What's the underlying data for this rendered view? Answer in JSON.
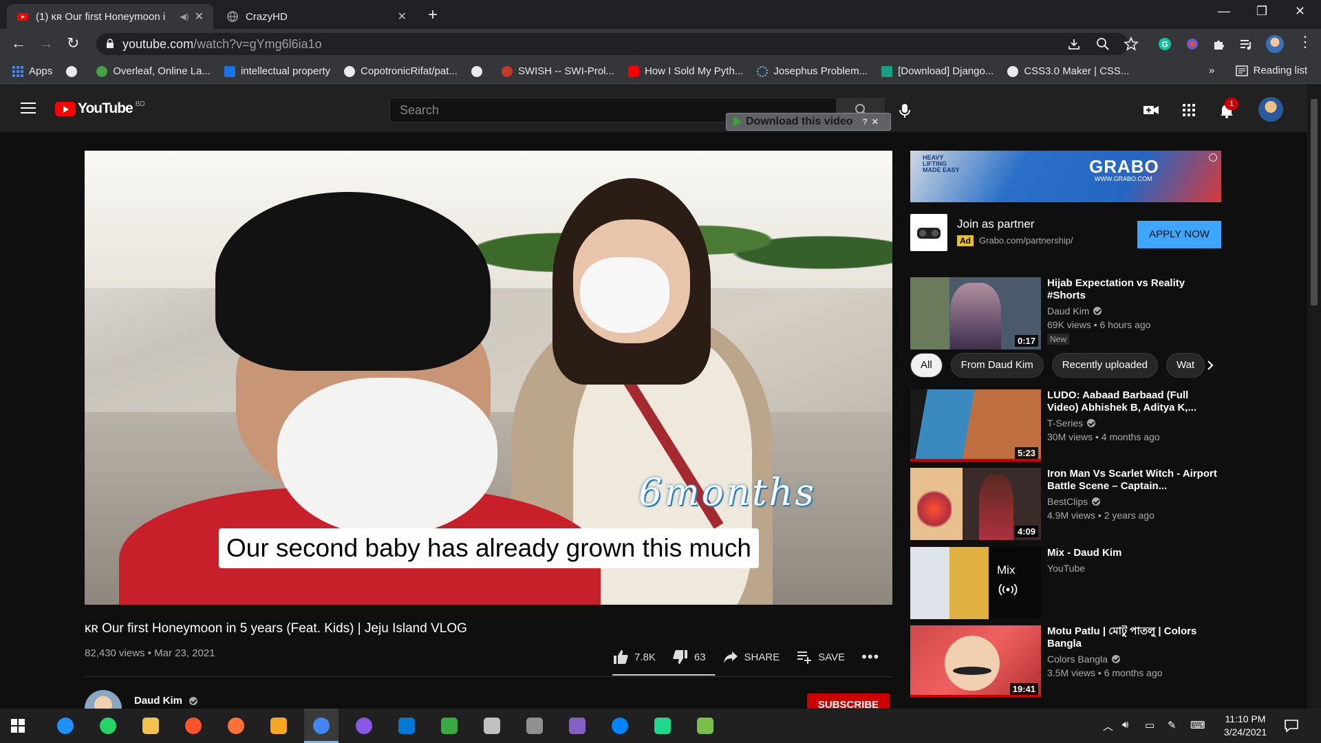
{
  "browser": {
    "tabs": [
      {
        "title": "(1) ᴋʀ Our first Honeymoon i",
        "active": true
      },
      {
        "title": "CrazyHD",
        "active": false
      }
    ],
    "url_host": "youtube.com",
    "url_path": "/watch?v=gYmg6l6ia1o",
    "bookmarks": [
      {
        "label": "Apps",
        "color": "#4285f4"
      },
      {
        "label": "",
        "color": "#e8eaed"
      },
      {
        "label": "Overleaf, Online La...",
        "color": "#47a141"
      },
      {
        "label": "intellectual property",
        "color": "#1a73e8"
      },
      {
        "label": "CopotronicRifat/pat...",
        "color": "#e8eaed"
      },
      {
        "label": "",
        "color": "#e8eaed"
      },
      {
        "label": "SWISH -- SWI-Prol...",
        "color": "#c0392b"
      },
      {
        "label": "How I Sold My Pyth...",
        "color": "#ff0000"
      },
      {
        "label": "Josephus Problem...",
        "color": "#8ab4f8"
      },
      {
        "label": "[Download] Django...",
        "color": "#16a085"
      },
      {
        "label": "CSS3.0 Maker | CSS...",
        "color": "#e8eaed"
      }
    ],
    "more_bookmarks": "»",
    "reading_list": "Reading list"
  },
  "youtube": {
    "logo_text": "YouTube",
    "country_code": "BD",
    "search_placeholder": "Search",
    "download_overlay": "Download this video",
    "notification_count": "1"
  },
  "video": {
    "overlay_text": "6months",
    "subtitle": "Our second baby has already grown this much",
    "title": "ᴋʀ Our first Honeymoon in 5 years (Feat. Kids) | Jeju Island VLOG",
    "meta": "82,430 views • Mar 23, 2021",
    "likes": "7.8K",
    "dislikes": "63",
    "like_ratio": 0.992,
    "share_label": "SHARE",
    "save_label": "SAVE",
    "channel": "Daud Kim",
    "subscribe_label": "SUBSCRIBE"
  },
  "ad": {
    "banner_brand": "GRABO",
    "banner_tagline": "HEAVY LIFTING MADE EASY",
    "banner_url": "WWW.GRABO.COM",
    "title": "Join as partner",
    "tag": "Ad",
    "url": "Grabo.com/partnership/",
    "cta": "APPLY NOW"
  },
  "chips": [
    "All",
    "From Daud Kim",
    "Recently uploaded",
    "Wat"
  ],
  "recommendations": [
    {
      "title": "Hijab Expectation vs Reality #Shorts",
      "channel": "Daud Kim",
      "verified": true,
      "views": "69K views • 6 hours ago",
      "duration": "0:17",
      "badge": "New",
      "watched": false,
      "color_a": "#6b7a5a",
      "color_b": "#2d3a4a"
    },
    {
      "title": "LUDO: Aabaad Barbaad (Full Video) Abhishek B, Aditya K,...",
      "channel": "T-Series",
      "verified": true,
      "views": "30M views • 4 months ago",
      "duration": "5:23",
      "badge": "",
      "watched": true,
      "color_a": "#3a8ac0",
      "color_b": "#c07040"
    },
    {
      "title": "Iron Man Vs Scarlet Witch - Airport Battle Scene – Captain...",
      "channel": "BestClips",
      "verified": true,
      "views": "4.9M views • 2 years ago",
      "duration": "4:09",
      "badge": "",
      "watched": false,
      "color_a": "#b03040",
      "color_b": "#e8c090"
    },
    {
      "title": "Mix - Daud Kim",
      "channel": "YouTube",
      "verified": false,
      "views": "",
      "duration": "",
      "badge": "",
      "watched": false,
      "mix_label": "Mix",
      "color_a": "#dfe4ea",
      "color_b": "#e0b040"
    },
    {
      "title": "Motu Patlu | মোটু পাতলু | Colors Bangla",
      "channel": "Colors Bangla",
      "verified": true,
      "views": "3.5M views • 6 months ago",
      "duration": "19:41",
      "badge": "",
      "watched": true,
      "color_a": "#d04848",
      "color_b": "#f0d0b0"
    }
  ],
  "taskbar": {
    "time": "11:10 PM",
    "date": "3/24/2021",
    "apps": [
      {
        "name": "edge-icon",
        "color": "#1e90ff"
      },
      {
        "name": "whatsapp-icon",
        "color": "#25d366"
      },
      {
        "name": "file-explorer-icon",
        "color": "#f2c14e"
      },
      {
        "name": "brave-icon",
        "color": "#fb542b"
      },
      {
        "name": "firefox-icon",
        "color": "#ff7139"
      },
      {
        "name": "paint-icon",
        "color": "#f5a623"
      },
      {
        "name": "chrome-icon",
        "color": "#4285f4"
      },
      {
        "name": "github-desktop-icon",
        "color": "#8957e5"
      },
      {
        "name": "vscode-icon",
        "color": "#0078d4"
      },
      {
        "name": "world-app-icon",
        "color": "#3aa845"
      },
      {
        "name": "umbrella-app-icon",
        "color": "#c0c0c0"
      },
      {
        "name": "tool-app-icon",
        "color": "#909090"
      },
      {
        "name": "visual-studio-icon",
        "color": "#8661c5"
      },
      {
        "name": "messenger-icon",
        "color": "#0084ff"
      },
      {
        "name": "pycharm-icon",
        "color": "#21d789"
      },
      {
        "name": "notepad-icon",
        "color": "#7bbf4a"
      }
    ]
  }
}
